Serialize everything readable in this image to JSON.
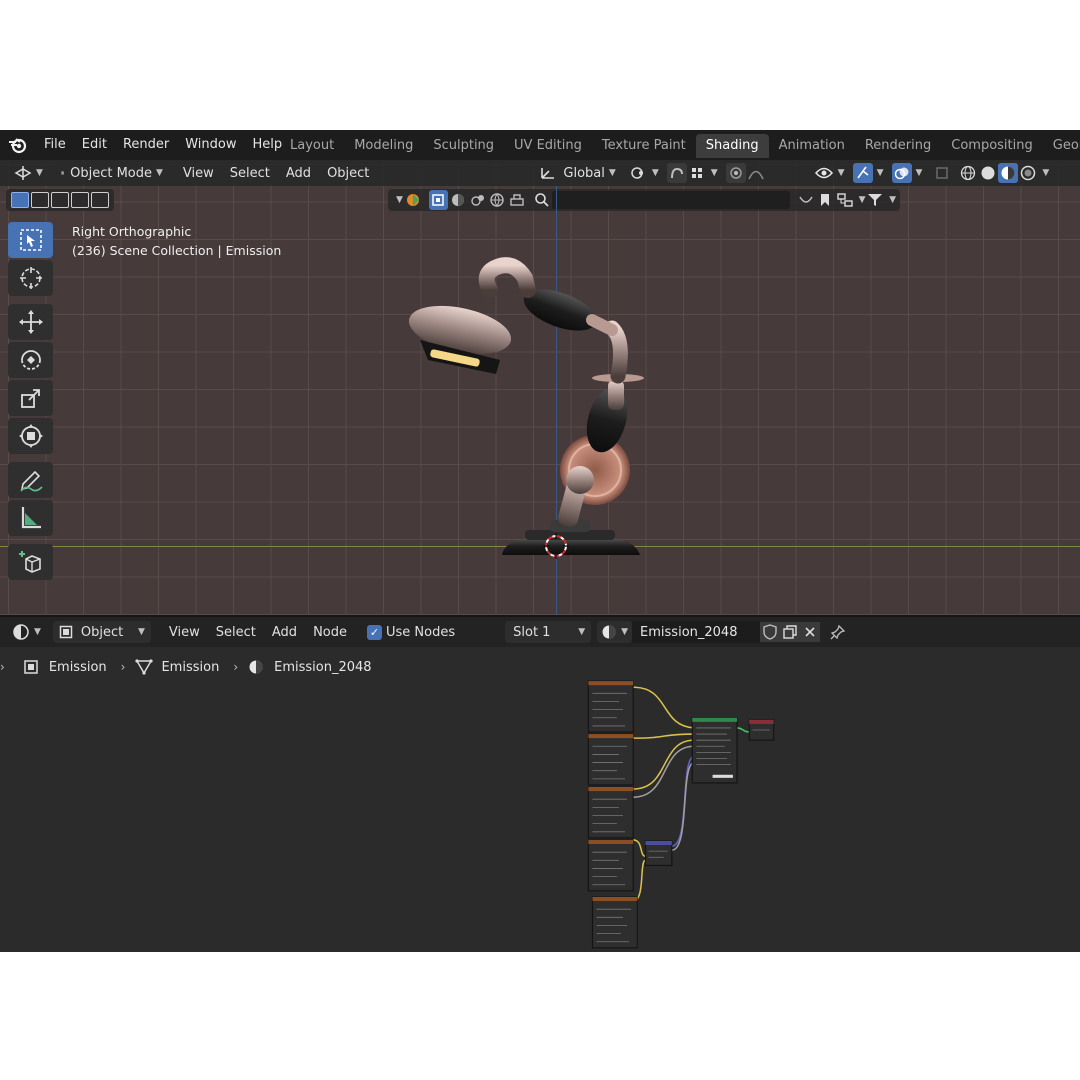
{
  "topbar": {
    "logo_icon": "blender-logo",
    "menus": [
      "File",
      "Edit",
      "Render",
      "Window",
      "Help"
    ],
    "workspaces": [
      "Layout",
      "Modeling",
      "Sculpting",
      "UV Editing",
      "Texture Paint",
      "Shading",
      "Animation",
      "Rendering",
      "Compositing",
      "Geometry Nodes"
    ],
    "active_workspace": "Shading"
  },
  "viewport": {
    "header": {
      "mode": "Object Mode",
      "menus": [
        "View",
        "Select",
        "Add",
        "Object"
      ],
      "transform_orientation": "Global"
    },
    "info": {
      "view_name": "Right Orthographic",
      "collection": "(236) Scene Collection | Emission"
    },
    "tools": [
      "select-box-icon",
      "cursor-icon",
      "move-icon",
      "rotate-icon",
      "scale-icon",
      "transform-icon",
      "annotate-icon",
      "measure-icon",
      "add-cube-icon"
    ],
    "grid_color": "#463a3a"
  },
  "shader_editor": {
    "header": {
      "editor_type_icon": "shader-editor-icon",
      "object_dropdown": "Object",
      "menus": [
        "View",
        "Select",
        "Add",
        "Node"
      ],
      "use_nodes_label": "Use Nodes",
      "use_nodes": true,
      "slot": "Slot 1",
      "material_name": "Emission_2048"
    },
    "breadcrumb": {
      "object": "Emission",
      "mesh": "Emission",
      "material": "Emission_2048"
    }
  },
  "accent": "#4772b3"
}
